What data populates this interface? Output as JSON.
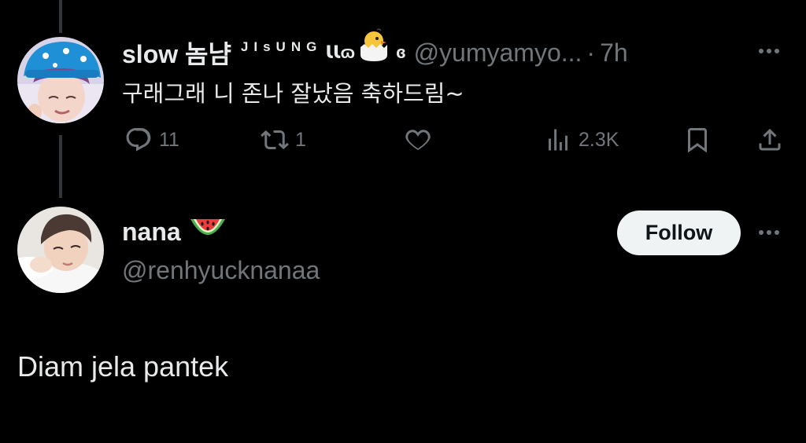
{
  "reply": {
    "display_name": "slow 놈냠",
    "name_decoration": "JIsUNG",
    "name_suffix_left": "ꙆꙆɷ",
    "name_suffix_right": "ɞ",
    "handle": "@yumyamyo...",
    "separator": "·",
    "time": "7h",
    "text": "구래그래 니 존나 잘났음 축하드림~",
    "actions": {
      "reply_count": "11",
      "repost_count": "1",
      "like_count": "",
      "views_count": "2.3K"
    }
  },
  "main_tweet": {
    "display_name": "nana",
    "name_emoji": "watermelon",
    "handle": "@renhyucknanaa",
    "follow_label": "Follow",
    "text": "Diam jela pantek"
  },
  "colors": {
    "background": "#000000",
    "text_primary": "#e7e9ea",
    "text_secondary": "#71767b",
    "thread_line": "#333639",
    "follow_bg": "#eff3f4",
    "follow_text": "#0f1419"
  }
}
